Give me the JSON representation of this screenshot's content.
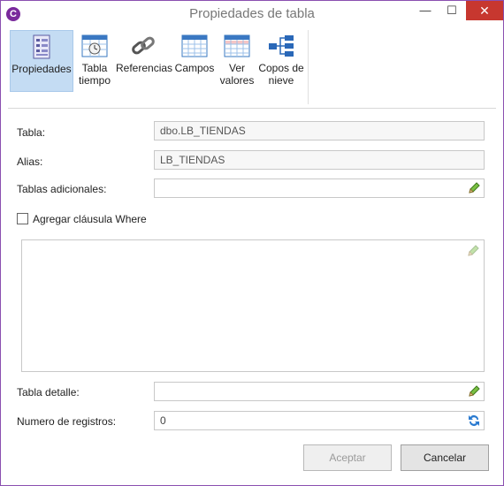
{
  "window": {
    "title": "Propiedades de tabla",
    "app_icon_glyph": "C",
    "minimize": "—",
    "maximize": "☐",
    "close": "✕",
    "accent_color": "#8a4fb0",
    "close_color": "#c7372f"
  },
  "ribbon": {
    "items": [
      {
        "label": "Propiedades",
        "icon": "properties-icon",
        "active": true
      },
      {
        "label": "Tabla tiempo",
        "icon": "time-table-icon",
        "active": false
      },
      {
        "label": "Referencias",
        "icon": "chain-link-icon",
        "active": false
      },
      {
        "label": "Campos",
        "icon": "fields-grid-icon",
        "active": false
      },
      {
        "label": "Ver valores",
        "icon": "view-values-icon",
        "active": false
      },
      {
        "label": "Copos de nieve",
        "icon": "snowflake-tree-icon",
        "active": false
      }
    ]
  },
  "form": {
    "tabla_label": "Tabla:",
    "tabla_value": "dbo.LB_TIENDAS",
    "alias_label": "Alias:",
    "alias_value": "LB_TIENDAS",
    "tablas_adicionales_label": "Tablas adicionales:",
    "tablas_adicionales_value": "",
    "where_checkbox_label": "Agregar cláusula Where",
    "where_checked": false,
    "where_text": "",
    "tabla_detalle_label": "Tabla detalle:",
    "tabla_detalle_value": "",
    "num_registros_label": "Numero de registros:",
    "num_registros_value": "0"
  },
  "buttons": {
    "accept": "Aceptar",
    "cancel": "Cancelar"
  }
}
